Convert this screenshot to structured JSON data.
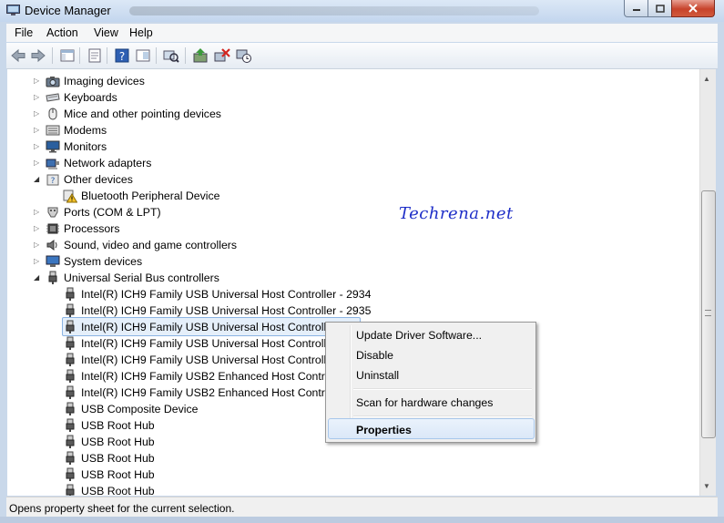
{
  "window": {
    "title": "Device Manager"
  },
  "menu": {
    "file": "File",
    "action": "Action",
    "view": "View",
    "help": "Help"
  },
  "toolbar": {
    "icons": [
      "back-icon",
      "forward-icon",
      "console-tree-icon",
      "properties-sheet-icon",
      "help-icon",
      "show-hide-icon",
      "scan-hardware-icon",
      "update-driver-icon",
      "uninstall-icon",
      "disable-icon"
    ]
  },
  "tree": {
    "categories": {
      "imaging": "Imaging devices",
      "keyboards": "Keyboards",
      "mice": "Mice and other pointing devices",
      "modems": "Modems",
      "monitors": "Monitors",
      "network": "Network adapters",
      "other": "Other devices",
      "bluetooth": "Bluetooth Peripheral Device",
      "ports": "Ports (COM & LPT)",
      "processors": "Processors",
      "sound": "Sound, video and game controllers",
      "system": "System devices",
      "usb": "Universal Serial Bus controllers"
    },
    "usb_devices": [
      "Intel(R) ICH9 Family USB Universal Host Controller - 2934",
      "Intel(R) ICH9 Family USB Universal Host Controller - 2935",
      "Intel(R) ICH9 Family USB Universal Host Controller",
      "Intel(R) ICH9 Family USB Universal Host Controller",
      "Intel(R) ICH9 Family USB Universal Host Controller",
      "Intel(R) ICH9 Family USB2 Enhanced Host Controller",
      "Intel(R) ICH9 Family USB2 Enhanced Host Controller",
      "USB Composite Device",
      "USB Root Hub",
      "USB Root Hub",
      "USB Root Hub",
      "USB Root Hub",
      "USB Root Hub"
    ]
  },
  "watermark": "Techrena.net",
  "context_menu": {
    "update_driver": "Update Driver Software...",
    "disable": "Disable",
    "uninstall": "Uninstall",
    "scan": "Scan for hardware changes",
    "properties": "Properties"
  },
  "status": {
    "text": "Opens property sheet for the current selection."
  },
  "colors": {
    "selection": "#e5effa",
    "selection_border": "#8bb4e3",
    "watermark": "#1f2fc8"
  }
}
